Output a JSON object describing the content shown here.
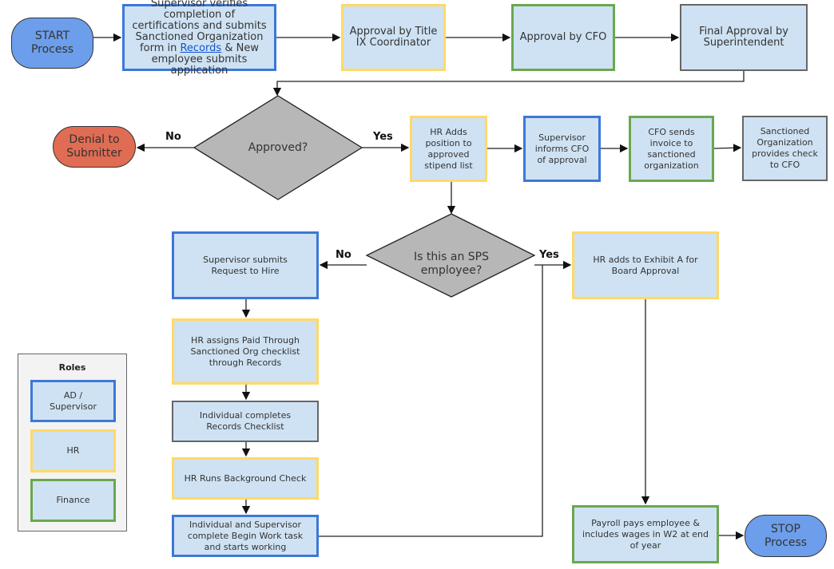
{
  "colors": {
    "process_fill": "#cfe2f3",
    "ad_supervisor": "#3c78d8",
    "hr": "#ffd966",
    "finance": "#6aa84f",
    "other": "#666666",
    "terminal": "#6d9eeb",
    "denial": "#e06c53",
    "decision": "#b7b7b7"
  },
  "start": "START Process",
  "stop": "STOP Process",
  "steps": {
    "supervisor_verifies_pre": "Supervisor verifies completion of certifications and submits Sanctioned Organization form in",
    "supervisor_verifies_link": "Records",
    "supervisor_verifies_post": "& New employee submits application",
    "title_ix": "Approval by Title IX Coordinator",
    "cfo_approval": "Approval by CFO",
    "final_approval": "Final Approval by Superintendent",
    "denial": "Denial to Submitter",
    "hr_adds_position": "HR Adds position to approved stipend list",
    "supervisor_informs": "Supervisor informs CFO of approval",
    "cfo_sends_invoice": "CFO sends invoice to sanctioned organization",
    "org_provides_check": "Sanctioned Organization provides check to CFO",
    "request_to_hire": "Supervisor submits Request to Hire",
    "exhibit_a": "HR adds to Exhibit A for Board Approval",
    "hr_assigns": "HR assigns Paid Through Sanctioned Org checklist through Records",
    "individual_checklist": "Individual completes Records Checklist",
    "background_check": "HR Runs Background Check",
    "begin_work": "Individual and Supervisor complete Begin Work task and starts working",
    "payroll": "Payroll pays employee & includes wages in W2 at end of year"
  },
  "decisions": {
    "approved": "Approved?",
    "sps": "Is this an SPS employee?"
  },
  "branch_labels": {
    "no1": "No",
    "yes1": "Yes",
    "no2": "No",
    "yes2": "Yes"
  },
  "legend": {
    "title": "Roles",
    "items": [
      {
        "label": "AD / Supervisor",
        "color": "#3c78d8"
      },
      {
        "label": "HR",
        "color": "#ffd966"
      },
      {
        "label": "Finance",
        "color": "#6aa84f"
      }
    ]
  }
}
